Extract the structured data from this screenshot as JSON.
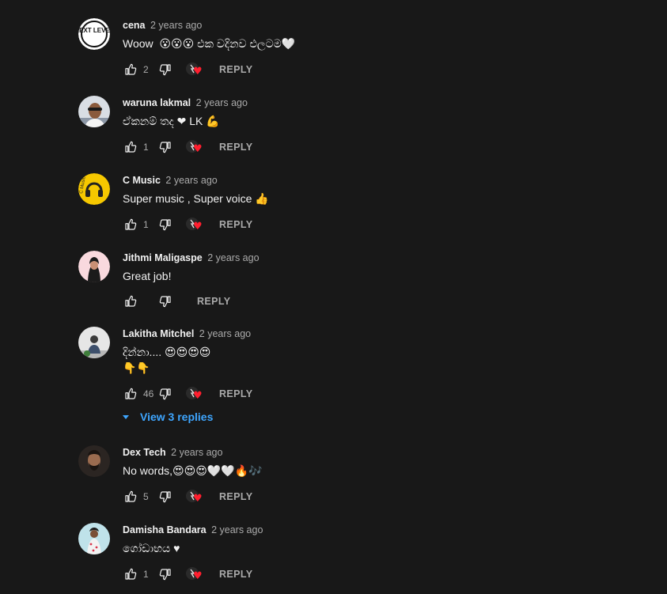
{
  "comments": [
    {
      "author": "cena",
      "time": "2 years ago",
      "text": "Woow  😮😮😮 එක වදිනව එලටම🤍",
      "likes": "2",
      "reply_label": "REPLY",
      "avatar_label": "NEXT LEVEL"
    },
    {
      "author": "waruna lakmal",
      "time": "2 years ago",
      "text": "ඒකනම් තද ❤ LK 💪",
      "likes": "1",
      "reply_label": "REPLY"
    },
    {
      "author": "C Music",
      "time": "2 years ago",
      "text": "Super music , Super voice 👍",
      "likes": "1",
      "reply_label": "REPLY",
      "avatar_label": "C Music"
    },
    {
      "author": "Jithmi Maligaspe",
      "time": "2 years ago",
      "text": "Great job!",
      "likes": "",
      "reply_label": "REPLY"
    },
    {
      "author": "Lakitha Mitchel",
      "time": "2 years ago",
      "text": "දින්නා.... 😍😍😍😍\n👇👇",
      "likes": "46",
      "reply_label": "REPLY",
      "view_replies": "View 3 replies"
    },
    {
      "author": "Dex Tech",
      "time": "2 years ago",
      "text": "No words,😍😍😍🤍🤍🔥🎶",
      "likes": "5",
      "reply_label": "REPLY"
    },
    {
      "author": "Damisha Bandara",
      "time": "2 years ago",
      "text": "ගෝඩාභය ♥",
      "likes": "1",
      "reply_label": "REPLY"
    }
  ],
  "colors": {
    "background": "#181818",
    "text": "#f1f1f1",
    "secondary": "#aaaaaa",
    "link": "#3ea6ff",
    "heart": "#ff1e2e"
  },
  "icons": {
    "like": "thumb-up-icon",
    "dislike": "thumb-down-icon",
    "creator_heart": "creator-heart-icon",
    "expand": "caret-down-icon"
  }
}
